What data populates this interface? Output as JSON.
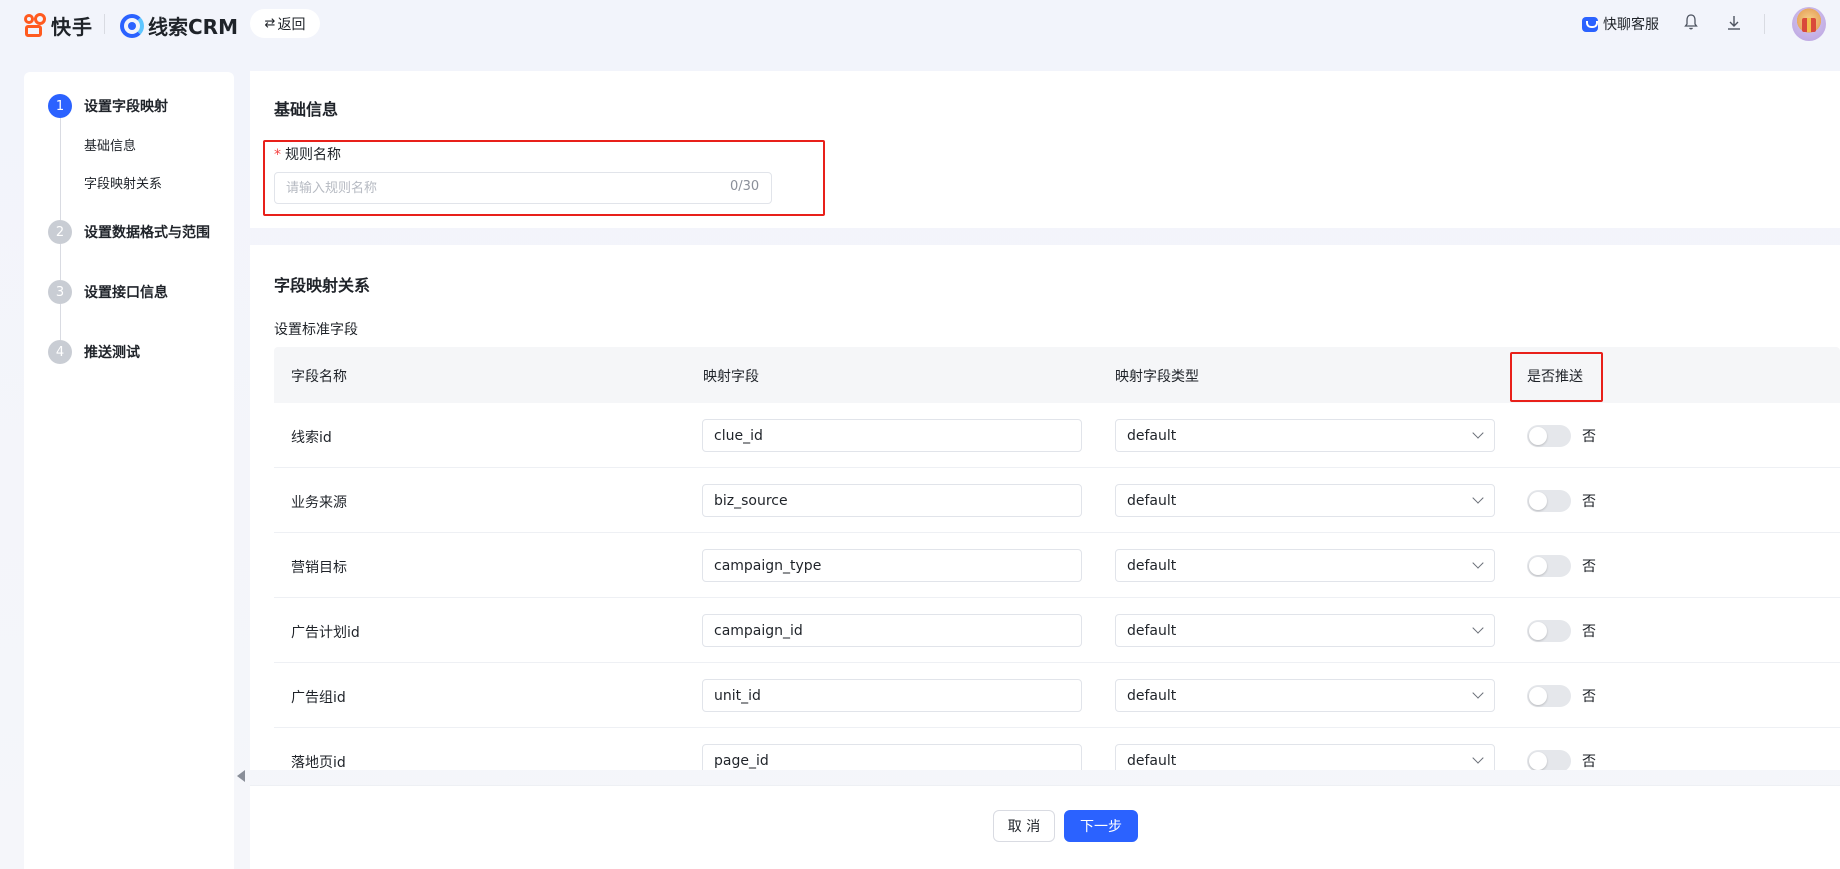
{
  "header": {
    "brand": "快手",
    "product": "线索CRM",
    "back_label": "返回",
    "back_icon": "⇄",
    "service_label": "快聊客服"
  },
  "steps": [
    {
      "num": "1",
      "label": "设置字段映射",
      "active": true
    },
    {
      "num": "2",
      "label": "设置数据格式与范围",
      "active": false
    },
    {
      "num": "3",
      "label": "设置接口信息",
      "active": false
    },
    {
      "num": "4",
      "label": "推送测试",
      "active": false
    }
  ],
  "substeps": [
    "基础信息",
    "字段映射关系"
  ],
  "basic": {
    "title": "基础信息",
    "rule_label": "规则名称",
    "rule_placeholder": "请输入规则名称",
    "rule_counter": "0/30"
  },
  "mapping": {
    "title": "字段映射关系",
    "subtitle": "设置标准字段",
    "columns": [
      "字段名称",
      "映射字段",
      "映射字段类型",
      "是否推送"
    ],
    "rows": [
      {
        "name": "线索id",
        "field": "clue_id",
        "type": "default",
        "push": "否"
      },
      {
        "name": "业务来源",
        "field": "biz_source",
        "type": "default",
        "push": "否"
      },
      {
        "name": "营销目标",
        "field": "campaign_type",
        "type": "default",
        "push": "否"
      },
      {
        "name": "广告计划id",
        "field": "campaign_id",
        "type": "default",
        "push": "否"
      },
      {
        "name": "广告组id",
        "field": "unit_id",
        "type": "default",
        "push": "否"
      },
      {
        "name": "落地页id",
        "field": "page_id",
        "type": "default",
        "push": "否"
      }
    ]
  },
  "footer": {
    "cancel_label": "取 消",
    "next_label": "下一步"
  },
  "colors": {
    "primary": "#2b62ff",
    "highlight": "#e8201a",
    "brand_orange": "#ff5a1f"
  }
}
